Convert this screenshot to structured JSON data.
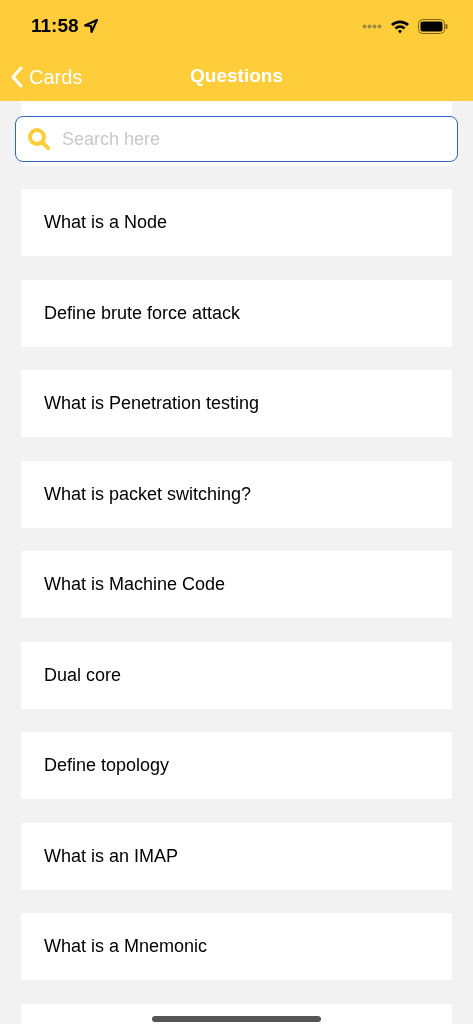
{
  "status_bar": {
    "time": "11:58"
  },
  "nav": {
    "back": "Cards",
    "title": "Questions"
  },
  "search": {
    "placeholder": "Search here"
  },
  "questions": [
    {
      "text": "What is a Node"
    },
    {
      "text": "Define brute force attack"
    },
    {
      "text": "What is Penetration testing"
    },
    {
      "text": "What is packet switching?"
    },
    {
      "text": "What is Machine Code"
    },
    {
      "text": "Dual core"
    },
    {
      "text": "Define topology"
    },
    {
      "text": "What is an IMAP"
    },
    {
      "text": "What is a Mnemonic"
    }
  ]
}
